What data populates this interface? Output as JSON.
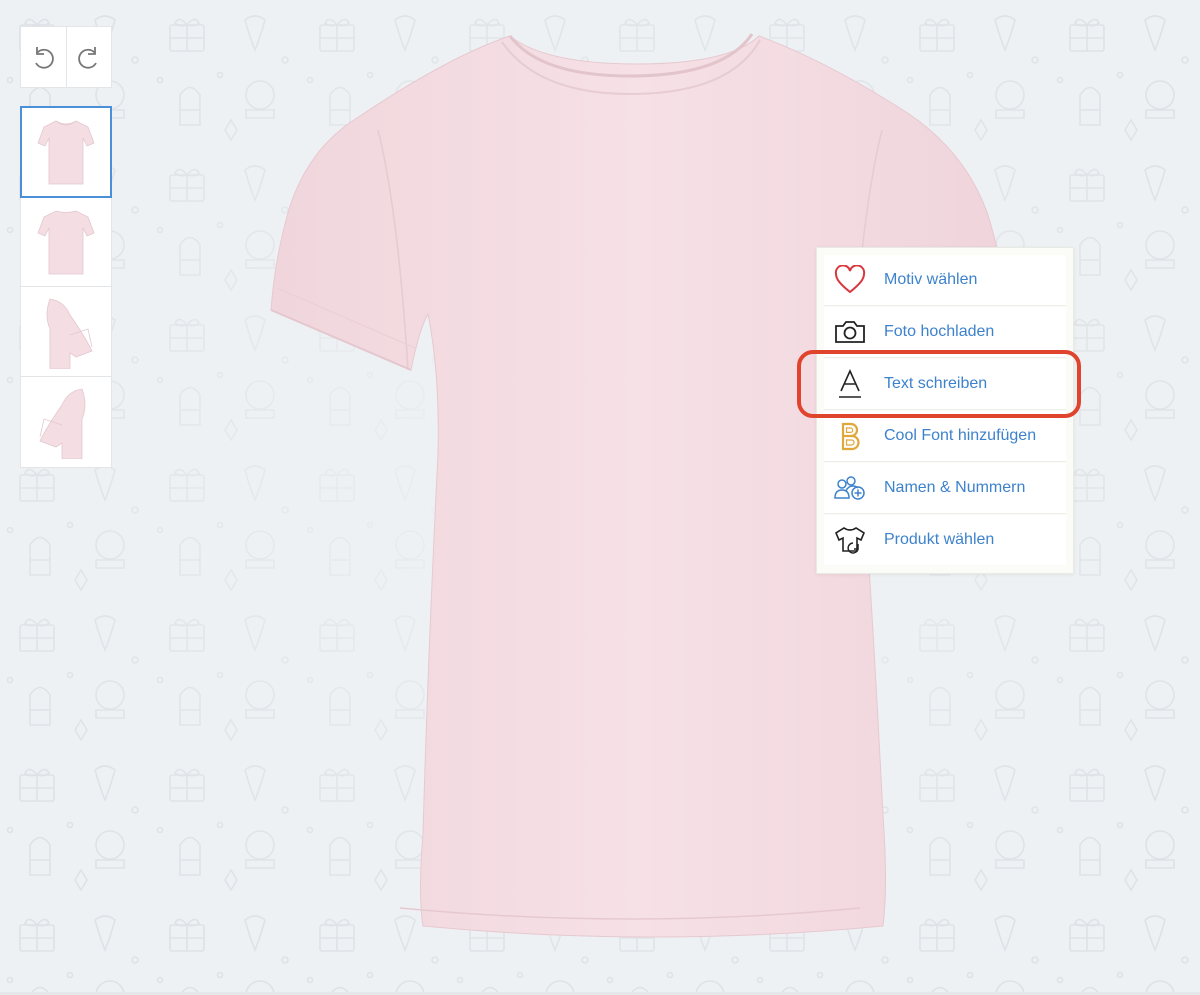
{
  "toolbar": {
    "undo_icon": "undo-icon",
    "redo_icon": "redo-icon"
  },
  "views": [
    {
      "name": "front",
      "icon": "shirt-front-thumbnail",
      "active": true
    },
    {
      "name": "back",
      "icon": "shirt-back-thumbnail",
      "active": false
    },
    {
      "name": "left",
      "icon": "shirt-left-sleeve-thumbnail",
      "active": false
    },
    {
      "name": "right",
      "icon": "shirt-right-sleeve-thumbnail",
      "active": false
    }
  ],
  "product": {
    "color": "#f4dde3"
  },
  "menu": {
    "items": [
      {
        "label": "Motiv wählen",
        "icon": "heart-icon"
      },
      {
        "label": "Foto hochladen",
        "icon": "camera-icon"
      },
      {
        "label": "Text schreiben",
        "icon": "text-icon"
      },
      {
        "label": "Cool Font hinzufügen",
        "icon": "cool-font-icon"
      },
      {
        "label": "Namen & Nummern",
        "icon": "team-names-icon"
      },
      {
        "label": "Produkt wählen",
        "icon": "shirt-swap-icon"
      }
    ],
    "highlighted_index": 2
  },
  "colors": {
    "accent": "#3d82cc",
    "highlight": "#e0442c",
    "heart": "#d9363e",
    "cool_font": "#e0a83a"
  }
}
